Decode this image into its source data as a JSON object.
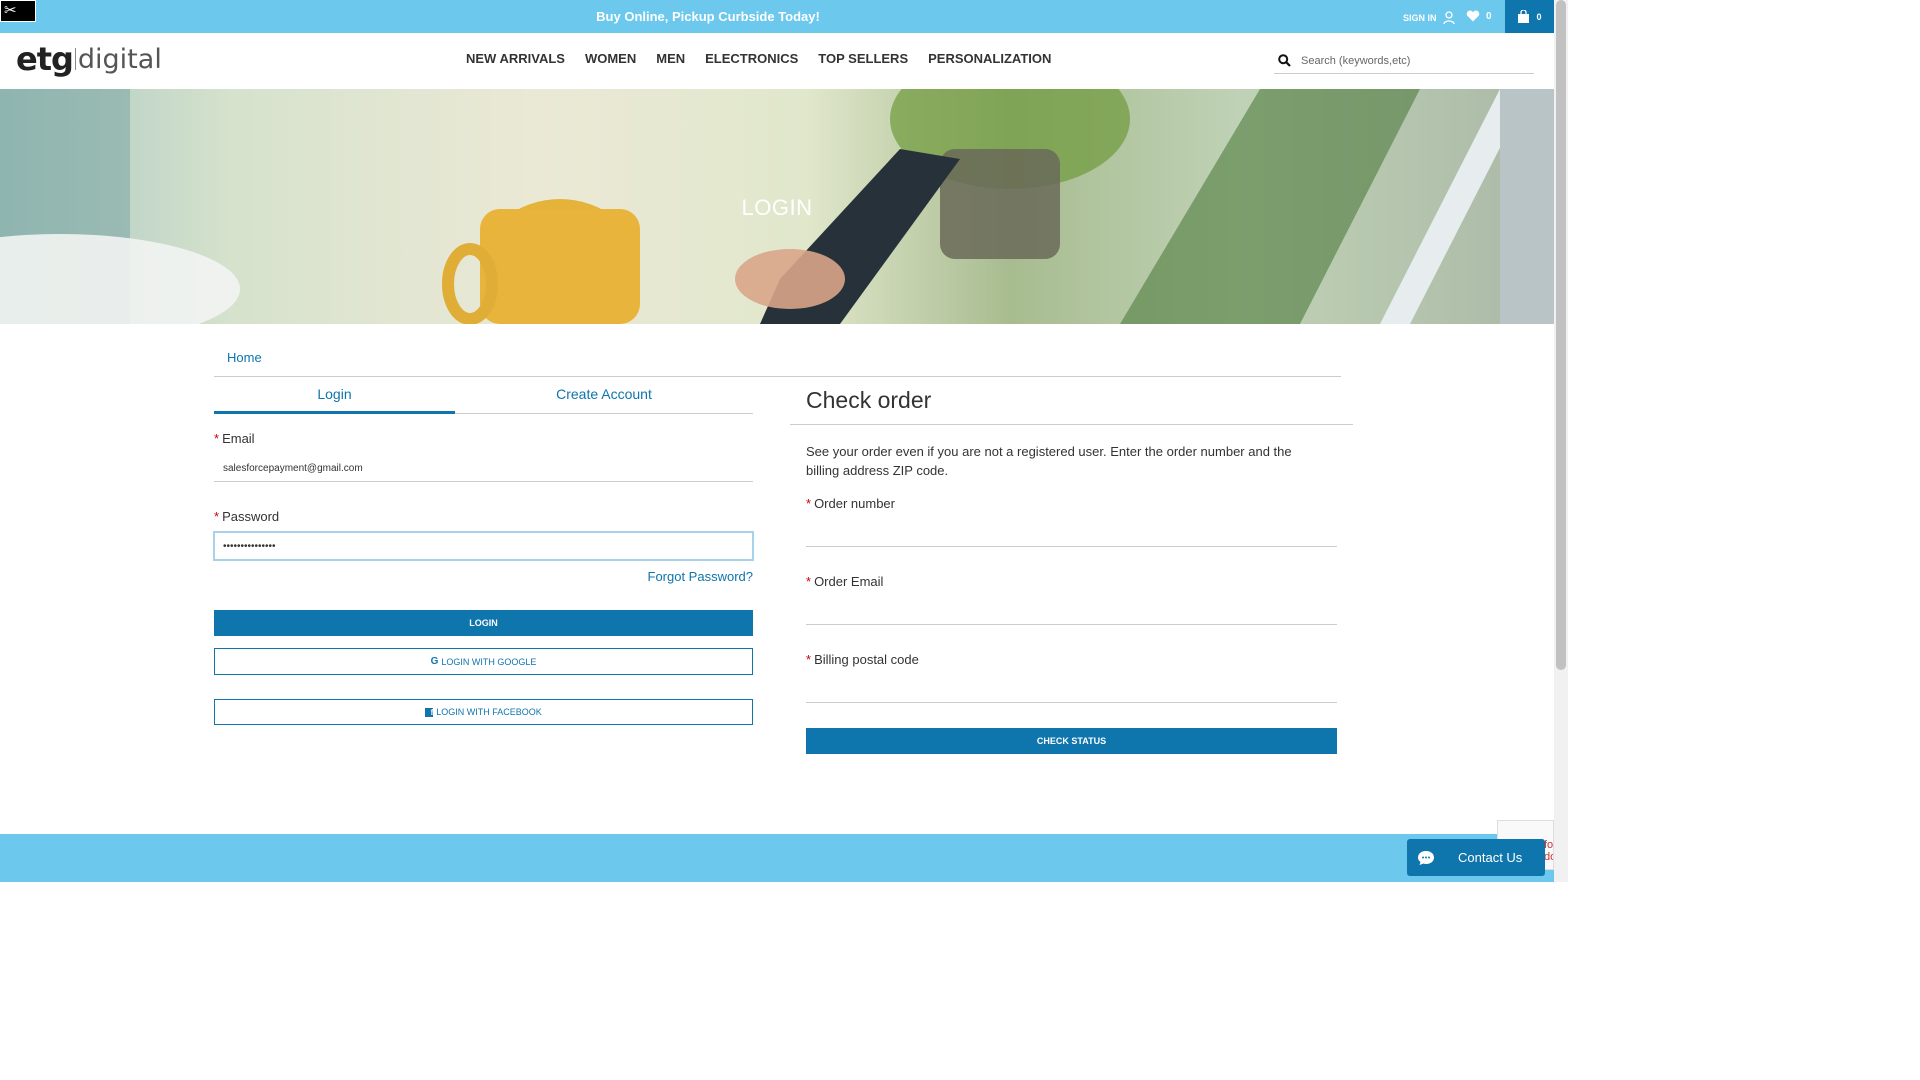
{
  "promo": {
    "text": "Buy Online, Pickup Curbside Today!"
  },
  "utility": {
    "sign_in_label": "SIGN IN",
    "wishlist_count": "0",
    "cart_count": "0"
  },
  "header": {
    "logo_part1": "etg",
    "logo_part2": "digital",
    "nav": [
      "NEW ARRIVALS",
      "WOMEN",
      "MEN",
      "ELECTRONICS",
      "TOP SELLERS",
      "PERSONALIZATION"
    ],
    "search_placeholder": "Search (keywords,etc)"
  },
  "hero": {
    "title": "LOGIN"
  },
  "breadcrumb": {
    "home": "Home"
  },
  "tabs": {
    "login": "Login",
    "create": "Create Account"
  },
  "login_form": {
    "email_label": "Email",
    "email_value": "salesforcepayment@gmail.com",
    "password_label": "Password",
    "password_value": "•••••••••••••••",
    "forgot_label": "Forgot Password?",
    "login_button": "LOGIN",
    "google_button": "LOGIN WITH GOOGLE",
    "facebook_button": "LOGIN WITH FACEBOOK"
  },
  "check_order": {
    "title": "Check order",
    "description": "See your order even if you are not a registered user. Enter the order number and the billing address ZIP code.",
    "order_number_label": "Order number",
    "order_email_label": "Order Email",
    "postal_code_label": "Billing postal code",
    "button": "CHECK STATUS"
  },
  "recaptcha_text": "fo do",
  "contact": {
    "label": "Contact Us"
  },
  "colors": {
    "accent": "#0f75ad",
    "promo_bg": "#6cc8ec",
    "required": "#cc0000"
  }
}
